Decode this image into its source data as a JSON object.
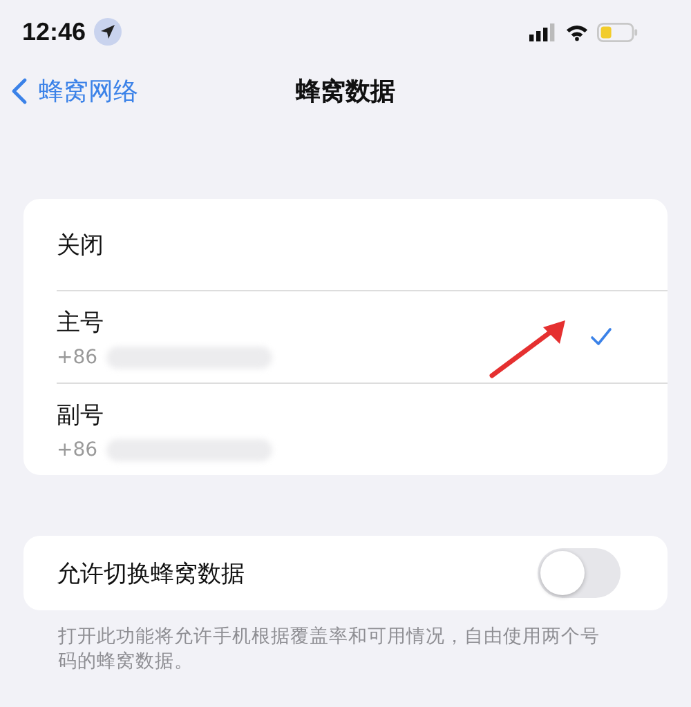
{
  "status_bar": {
    "time": "12:46"
  },
  "nav": {
    "back": "蜂窝网络",
    "title": "蜂窝数据"
  },
  "options": [
    {
      "name": "关闭",
      "selected": false
    },
    {
      "name": "主号",
      "number": "+86",
      "selected": true
    },
    {
      "name": "副号",
      "number": "+86",
      "selected": false
    }
  ],
  "switch_row": {
    "label": "允许切换蜂窝数据",
    "on": false
  },
  "footnote": "打开此功能将允许手机根据覆盖率和可用情况，自由使用两个号码的蜂窝数据。"
}
